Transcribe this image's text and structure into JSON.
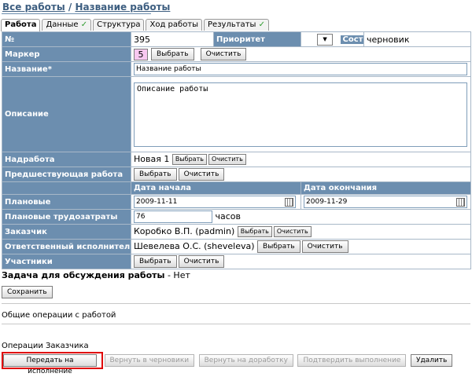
{
  "breadcrumb": {
    "all_jobs": "Все работы",
    "separator": "/",
    "job_name": "Название работы"
  },
  "tabs": [
    {
      "label": "Работа",
      "check": ""
    },
    {
      "label": "Данные",
      "check": "✓"
    },
    {
      "label": "Структура",
      "check": ""
    },
    {
      "label": "Ход работы",
      "check": ""
    },
    {
      "label": "Результаты",
      "check": "✓"
    }
  ],
  "form": {
    "number_label": "№",
    "number_value": "395",
    "priority_label": "Приоритет",
    "state_label": "Состояние",
    "state_value": "черновик",
    "marker_label": "Маркер",
    "marker_value": "5",
    "name_label": "Название*",
    "name_value": "Название работы",
    "description_label": "Описание",
    "description_value": "Описание работы",
    "parent_label": "Надработа",
    "parent_value": "Новая 1",
    "previous_label": "Предшествующая работа",
    "start_header": "Дата начала",
    "end_header": "Дата окончания",
    "planned_label": "Плановые",
    "planned_start": "2009-11-11",
    "planned_end": "2009-11-29",
    "effort_label": "Плановые трудозатраты",
    "effort_value": "76",
    "effort_unit": "часов",
    "customer_label": "Заказчик",
    "customer_value": "Коробко В.П. (padmin)",
    "responsible_label": "Ответственный исполнитель",
    "responsible_value": "Шевелева О.С. (sheveleva)",
    "participants_label": "Участники"
  },
  "buttons": {
    "select": "Выбрать",
    "clear": "Очистить",
    "save": "Сохранить"
  },
  "discussion": {
    "label": "Задача для обсуждения работы",
    "value": "- Нет"
  },
  "general_ops": "Общие операции с работой",
  "customer_ops": {
    "title": "Операции Заказчика",
    "send": "Передать на исполнение",
    "to_drafts": "Вернуть в черновики",
    "to_rework": "Вернуть на доработку",
    "confirm": "Подтвердить выполнение",
    "delete": "Удалить"
  }
}
